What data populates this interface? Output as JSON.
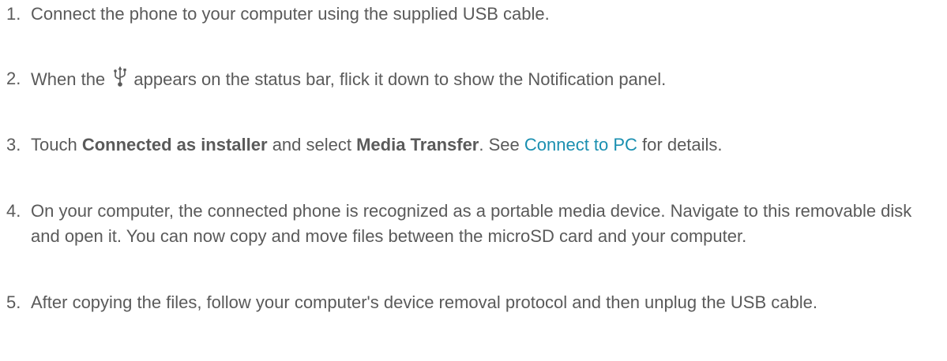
{
  "steps": [
    {
      "number": "1.",
      "text": "Connect the phone to your computer using the supplied USB cable."
    },
    {
      "number": "2.",
      "before_icon": "When the",
      "icon": "usb-icon",
      "after_icon": "appears on the status bar, flick it down to show the Notification panel."
    },
    {
      "number": "3.",
      "part1": "Touch ",
      "bold1": "Connected as installer",
      "part2": " and select ",
      "bold2": "Media Transfer",
      "part3": ". See ",
      "link": "Connect to PC",
      "part4": " for details."
    },
    {
      "number": "4.",
      "text": "On your computer, the connected phone is recognized as a portable media device. Navigate to this removable disk and open it. You can now copy and move files between the microSD card and your computer."
    },
    {
      "number": "5.",
      "text": "After copying the files, follow your computer's device removal protocol and then unplug the USB cable."
    }
  ],
  "colors": {
    "text": "#5a5a5a",
    "link": "#1a8fb0"
  }
}
